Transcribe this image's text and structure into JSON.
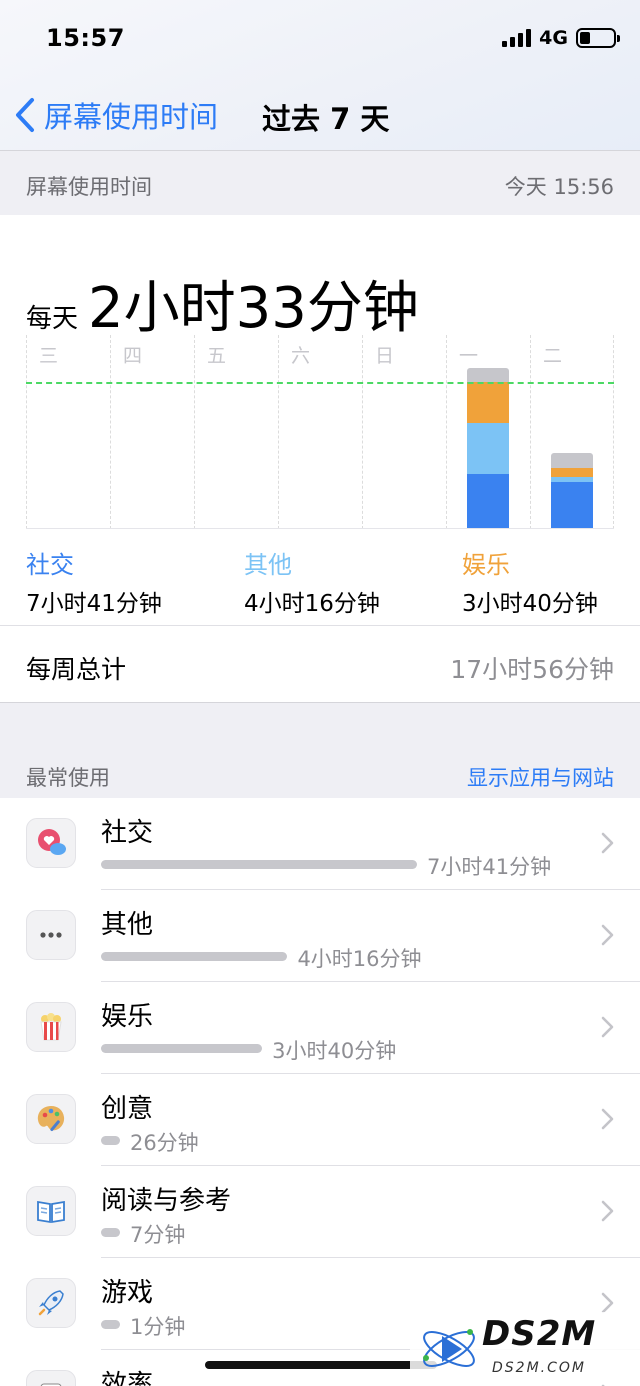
{
  "status_bar": {
    "time": "15:57",
    "network": "4G",
    "battery_level": 0.3
  },
  "nav": {
    "back_label": "屏幕使用时间",
    "title": "过去 7 天"
  },
  "summary_header": {
    "title": "屏幕使用时间",
    "updated": "今天 15:56"
  },
  "daily_average": {
    "prefix": "每天",
    "value": "2小时33分钟"
  },
  "chart_data": {
    "type": "bar",
    "stacked": true,
    "categories": [
      "三",
      "四",
      "五",
      "六",
      "日",
      "一",
      "二"
    ],
    "series": [
      {
        "name": "社交",
        "color": "#3a82f0",
        "values": [
          0,
          0,
          0,
          0,
          0,
          0.97,
          0.82
        ]
      },
      {
        "name": "其他",
        "color": "#7cc3f5",
        "values": [
          0,
          0,
          0,
          0,
          0,
          0.88,
          0.1
        ]
      },
      {
        "name": "娱乐",
        "color": "#f0a23a",
        "values": [
          0,
          0,
          0,
          0,
          0,
          0.72,
          0.15
        ]
      },
      {
        "name": "",
        "color": "#c6c6cb",
        "values": [
          0,
          0,
          0,
          0,
          0,
          0.26,
          0.26
        ]
      }
    ],
    "average_line": 2.55,
    "ylim": [
      0,
      3.4
    ],
    "grid": true,
    "legend": [
      {
        "label": "社交",
        "value": "7小时41分钟",
        "color": "#3a82f0"
      },
      {
        "label": "其他",
        "value": "4小时16分钟",
        "color": "#7cc3f5"
      },
      {
        "label": "娱乐",
        "value": "3小时40分钟",
        "color": "#f0a23a"
      }
    ]
  },
  "weekly_total": {
    "label": "每周总计",
    "value": "17小时56分钟"
  },
  "most_used_header": {
    "title": "最常使用",
    "action": "显示应用与网站"
  },
  "categories_list": [
    {
      "name": "社交",
      "time": "7小时41分钟",
      "fraction": 1.0,
      "icon": "social-icon"
    },
    {
      "name": "其他",
      "time": "4小时16分钟",
      "fraction": 0.59,
      "icon": "more-icon"
    },
    {
      "name": "娱乐",
      "time": "3小时40分钟",
      "fraction": 0.51,
      "icon": "popcorn-icon"
    },
    {
      "name": "创意",
      "time": "26分钟",
      "fraction": 0.06,
      "icon": "palette-icon"
    },
    {
      "name": "阅读与参考",
      "time": "7分钟",
      "fraction": 0.06,
      "icon": "book-icon"
    },
    {
      "name": "游戏",
      "time": "1分钟",
      "fraction": 0.06,
      "icon": "rocket-icon"
    },
    {
      "name": "效率",
      "time": "",
      "fraction": 0.0,
      "icon": "productivity-icon"
    }
  ],
  "watermark": {
    "brand": "DS2M",
    "url": "DS2M.COM"
  }
}
